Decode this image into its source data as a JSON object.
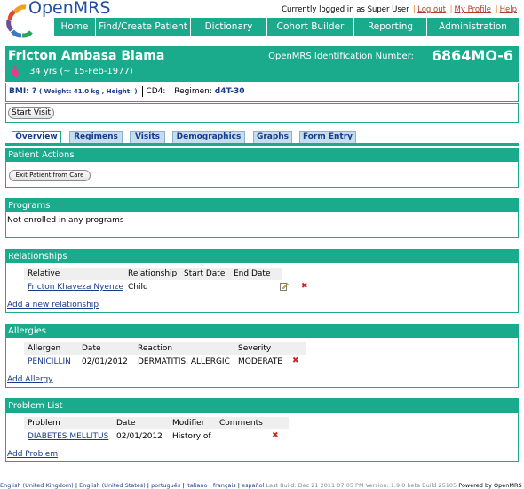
{
  "header": {
    "app_name": "OpenMRS",
    "logged_in": "Currently logged in as Super User",
    "logout": "Log out",
    "profile": "My Profile",
    "help": "Help"
  },
  "nav": [
    "Home",
    "Find/Create Patient",
    "Dictionary",
    "Cohort Builder",
    "Reporting",
    "Administration"
  ],
  "patient": {
    "name": "Fricton Ambasa Biama",
    "age": "34 yrs (~ 15-Feb-1977)",
    "ident_label": "OpenMRS Identification Number:",
    "ident_value": "6864MO-6",
    "bmi_label": "BMI: ?",
    "weight_height": "( Weight: 41.0 kg , Height: )",
    "cd4": "CD4:",
    "regimen_label": "Regimen:",
    "regimen_value": "d4T-30"
  },
  "start_visit": "Start Visit",
  "tabs": [
    "Overview",
    "Regimens",
    "Visits",
    "Demographics",
    "Graphs",
    "Form Entry"
  ],
  "patient_actions": {
    "title": "Patient Actions",
    "exit_button": "Exit Patient from Care"
  },
  "programs": {
    "title": "Programs",
    "text": "Not enrolled in any programs"
  },
  "relationships": {
    "title": "Relationships",
    "headers": [
      "Relative",
      "Relationship",
      "Start Date",
      "End Date"
    ],
    "row": [
      "Fricton Khaveza Nyenze",
      "Child"
    ],
    "add_link": "Add a new relationship"
  },
  "allergies": {
    "title": "Allergies",
    "headers": [
      "Allergen",
      "Date",
      "Reaction",
      "Severity"
    ],
    "row": [
      "PENICILLIN",
      "02/01/2012",
      "DERMATITIS, ALLERGIC",
      "MODERATE"
    ],
    "add_link": "Add Allergy"
  },
  "problems": {
    "title": "Problem List",
    "headers": [
      "Problem",
      "Date",
      "Modifier",
      "Comments"
    ],
    "row": [
      "DIABETES MELLITUS",
      "02/01/2012",
      "History of"
    ],
    "add_link": "Add Problem"
  },
  "footer": {
    "languages": [
      "English (United Kingdom)",
      "English (United States)",
      "português",
      "italiano",
      "français",
      "español"
    ],
    "build": "Last Build: Dec 21 2011 07:05 PM   Version: 1.9.0 beta Build 25105",
    "powered": "Powered by OpenMRS"
  },
  "colors": {
    "teal": "#1aaa8c",
    "link": "#1a3a8a",
    "tab": "#c7dcec"
  }
}
